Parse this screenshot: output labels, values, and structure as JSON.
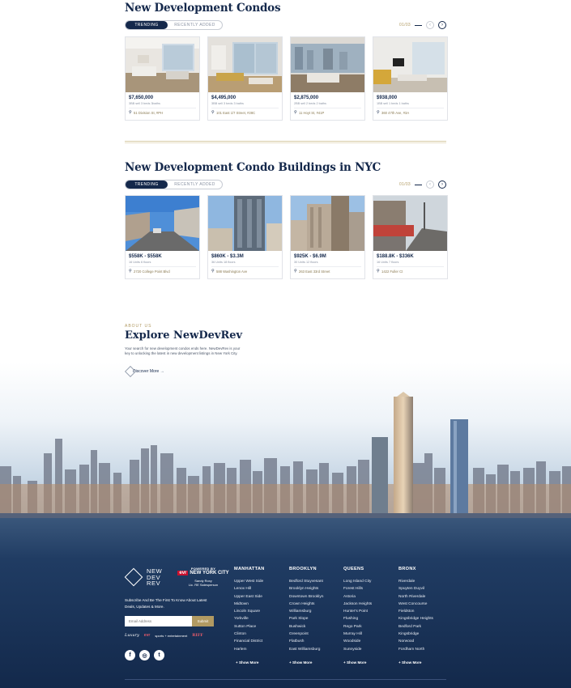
{
  "condos": {
    "title": "New Development Condos",
    "tabs": [
      "TRENDING",
      "RECENTLY ADDED"
    ],
    "pager": "01/03",
    "cards": [
      {
        "price": "$7,650,000",
        "meta": "3BB sell 3 beds 3baths",
        "address": "51 Division St, #PH"
      },
      {
        "price": "$4,495,000",
        "meta": "3BB sell 3 beds 3 baths",
        "address": "101 East 1/7 Street, #28C"
      },
      {
        "price": "$2,875,000",
        "meta": "2BB sell 2 beds 2 baths",
        "address": "11 Hoyt St, #41P"
      },
      {
        "price": "$938,000",
        "meta": "1BB sell 1 beds 1 baths",
        "address": "360 47th Ave, #3A"
      }
    ]
  },
  "buildings": {
    "title": "New Development Condo Buildings in NYC",
    "tabs": [
      "TRENDING",
      "RECENTLY ADDED"
    ],
    "pager": "01/03",
    "cards": [
      {
        "price": "$558K - $558K",
        "meta": "16 Units 6 floors",
        "address": "2720 College Point Blvd"
      },
      {
        "price": "$860K - $3.3M",
        "meta": "36 Units 18 floors",
        "address": "588 Washington Ave"
      },
      {
        "price": "$925K - $6.9M",
        "meta": "30 Units 12 floors",
        "address": "263 East 33rd Street"
      },
      {
        "price": "$188.8K - $336K",
        "meta": "16 Units 7 floors",
        "address": "1422 Fuller Ct"
      }
    ]
  },
  "about": {
    "kicker": "ABOUT US",
    "title": "Explore NewDevRev",
    "text": "Your search for new development condos ends here. NewDevRev is your key to unlocking the latest in new development listings in New York City.",
    "button": "Discover More →"
  },
  "footer": {
    "logo": [
      "NEW",
      "DEV",
      "REV"
    ],
    "powered_by": "POWERED BY",
    "brand_red": "evr",
    "brand": "NEW YORK CITY",
    "agent_name": "Sandy Roxy",
    "agent_title": "Lic. RE Salesperson",
    "subscribe": "Subscribe And Be The First To Know About Latest Deals, Updates & More.",
    "email_placeholder": "Email Address",
    "submit": "Submit",
    "partners": [
      "Luxury",
      "evr",
      "sports + entertainment",
      "RIFF"
    ],
    "social": [
      "f",
      "◎",
      "t"
    ],
    "columns": [
      {
        "title": "MANHATTAN",
        "items": [
          "Upper West Side",
          "Lenox Hill",
          "Upper East Side",
          "Midtown",
          "Lincoln Square",
          "Yorkville",
          "Sutton Place",
          "Clinton",
          "Financial District",
          "Harlem"
        ],
        "more": "+ Show More"
      },
      {
        "title": "BROOKLYN",
        "items": [
          "Bedford Stuyvesant",
          "Brooklyn Heights",
          "Downtown Brooklyn",
          "Crown Heights",
          "Williamsburg",
          "Park Slope",
          "Bushwick",
          "Greenpoint",
          "Flatbush",
          "East Williamsburg"
        ],
        "more": "+ Show More"
      },
      {
        "title": "QUEENS",
        "items": [
          "Long Island City",
          "Forest Hills",
          "Astoria",
          "Jackson Heights",
          "Hunter's Point",
          "Flushing",
          "Rego Park",
          "Murray Hill",
          "Woodside",
          "Sunnyside"
        ],
        "more": "+ Show More"
      },
      {
        "title": "BRONX",
        "items": [
          "Riverdale",
          "Spuyten Duyvil",
          "North Riverdale",
          "West Concourse",
          "Fieldston",
          "Kingsbridge Heights",
          "Bedford Park",
          "Kingsbridge",
          "Norwood",
          "Fordham North"
        ],
        "more": "+ Show More"
      }
    ]
  }
}
